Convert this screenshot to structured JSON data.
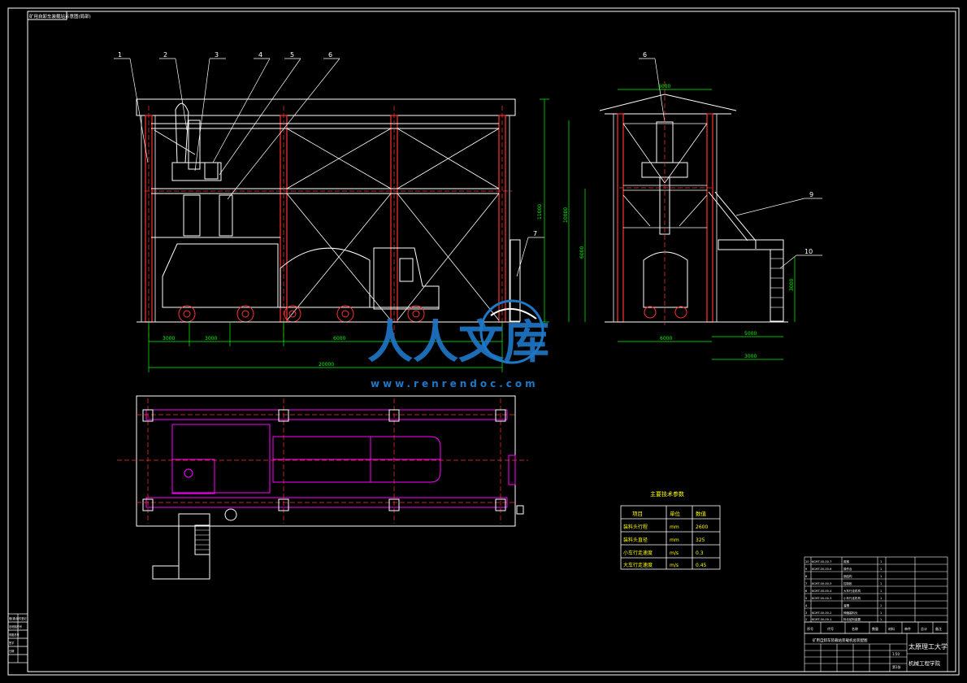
{
  "sheet": {
    "corner_tag": "矿用自卸车装载站示意图(局部)",
    "colors": {
      "background": "#000000",
      "line": "#ffffff",
      "structure": "#ff3333",
      "plan": "#ff00ff",
      "dimension": "#00ff00",
      "note": "#ffff00"
    }
  },
  "callouts": [
    "1",
    "2",
    "3",
    "4",
    "5",
    "6",
    "6",
    "7",
    "9",
    "10"
  ],
  "dimensions": {
    "front_bays": [
      "3000",
      "3000",
      "6000"
    ],
    "front_total": "20000",
    "front_height": "11000",
    "side_width": "6000",
    "side_bottom": "6000",
    "side_right": [
      "5000",
      "3000"
    ],
    "side_heights": [
      "10000",
      "6000",
      "3000"
    ],
    "stair_height": "3000"
  },
  "watermark": {
    "brand": "人人文库",
    "url": "www.renrendoc.com"
  },
  "parameters": {
    "title": "主要技术参数",
    "headers": [
      "项目",
      "单位",
      "数值"
    ],
    "rows": [
      [
        "装料头行程",
        "mm",
        "2600"
      ],
      [
        "装料头直径",
        "mm",
        "325"
      ],
      [
        "小车行走速度",
        "m/s",
        "0.3"
      ],
      [
        "大车行走速度",
        "m/s",
        "0.45"
      ]
    ]
  },
  "parts_list": {
    "rows": [
      [
        "10",
        "KCMT-00-00-7",
        "爬梯",
        "1"
      ],
      [
        "9",
        "KCMT-00-00-6",
        "操作台",
        "1"
      ],
      [
        "8",
        "",
        "钢结构",
        "1"
      ],
      [
        "7",
        "KCMT-00-00-5",
        "控制柜",
        "1"
      ],
      [
        "6",
        "KCMT-00-00-4",
        "大车行走机构",
        "1"
      ],
      [
        "5",
        "KCMT-00-00-3",
        "小车行走机构",
        "1"
      ],
      [
        "4",
        "",
        "溜槽",
        "1"
      ],
      [
        "3",
        "KCMT-00-00-2",
        "伸缩装料头",
        "1"
      ],
      [
        "2",
        "KCMT-00-00-1",
        "料仓给料装置",
        "1"
      ]
    ],
    "header": [
      "序号",
      "代号",
      "名称",
      "数量",
      "材料",
      "单件",
      "总计",
      "备注"
    ]
  },
  "title_block": {
    "drawing_title": "矿用自卸车装载站装载机总装配图",
    "school": "太原理工大学",
    "dept": "机械工程学院",
    "scale": "1:50",
    "sheet": "第1张"
  },
  "revision_block": [
    "借(通)用件登记",
    "旧底图总号",
    "底图总号",
    "签字",
    "日期"
  ]
}
